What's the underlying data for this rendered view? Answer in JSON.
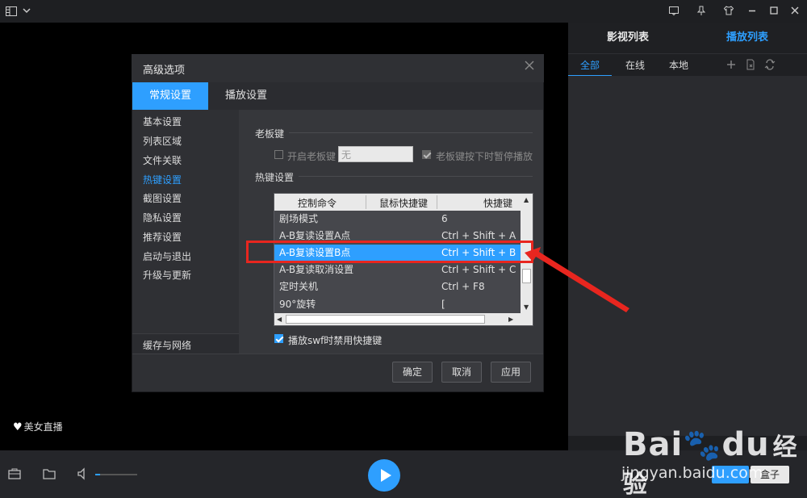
{
  "titlebar": {
    "icons": [
      "layout-icon",
      "chevron-down-icon",
      "message-icon",
      "pin-icon",
      "skin-icon",
      "minimize-icon",
      "maximize-icon",
      "close-icon"
    ]
  },
  "player": {
    "live_badge": "美女直播"
  },
  "right_panel": {
    "tabs": [
      {
        "label": "影视列表",
        "active": false
      },
      {
        "label": "播放列表",
        "active": true
      }
    ],
    "subtabs": [
      {
        "label": "全部",
        "active": true
      },
      {
        "label": "在线",
        "active": false
      },
      {
        "label": "本地",
        "active": false
      }
    ],
    "tool_icons": [
      "add-icon",
      "file-x-icon",
      "loop-icon"
    ]
  },
  "bottom_bar": {
    "volume_level": 0.12,
    "box_label": "盒子"
  },
  "dialog": {
    "title": "高级选项",
    "tabs": [
      {
        "label": "常规设置",
        "active": true
      },
      {
        "label": "播放设置",
        "active": false
      }
    ],
    "nav": [
      {
        "label": "基本设置",
        "active": false
      },
      {
        "label": "列表区域",
        "active": false
      },
      {
        "label": "文件关联",
        "active": false
      },
      {
        "label": "热键设置",
        "active": true
      },
      {
        "label": "截图设置",
        "active": false
      },
      {
        "label": "隐私设置",
        "active": false
      },
      {
        "label": "推荐设置",
        "active": false
      },
      {
        "label": "启动与退出",
        "active": false
      },
      {
        "label": "升级与更新",
        "active": false
      }
    ],
    "nav_bottom": "缓存与网络",
    "boss_key": {
      "section": "老板键",
      "enable_label": "开启老板键",
      "input_value": "无",
      "pause_label": "老板键按下时暂停播放"
    },
    "hotkeys": {
      "section": "热键设置",
      "columns": [
        "控制命令",
        "鼠标快捷键",
        "快捷键"
      ],
      "rows": [
        {
          "command": "剧场模式",
          "mouse": "",
          "key": "6"
        },
        {
          "command": "A-B复读设置A点",
          "mouse": "",
          "key": "Ctrl + Shift + A"
        },
        {
          "command": "A-B复读设置B点",
          "mouse": "",
          "key": "Ctrl + Shift + B"
        },
        {
          "command": "A-B复读取消设置",
          "mouse": "",
          "key": "Ctrl + Shift + C"
        },
        {
          "command": "定时关机",
          "mouse": "",
          "key": "Ctrl + F8"
        },
        {
          "command": "90°旋转",
          "mouse": "",
          "key": "["
        }
      ],
      "selected_row": 2,
      "swf_label": "播放swf时禁用快捷键"
    },
    "buttons": {
      "ok": "确定",
      "cancel": "取消",
      "apply": "应用"
    }
  },
  "watermark": {
    "brand_a": "Bai",
    "brand_b": "du",
    "brand_c": "经验",
    "url": "jingyan.baidu.com"
  },
  "colors": {
    "accent": "#2e9fff",
    "annotation": "#e8261f"
  }
}
